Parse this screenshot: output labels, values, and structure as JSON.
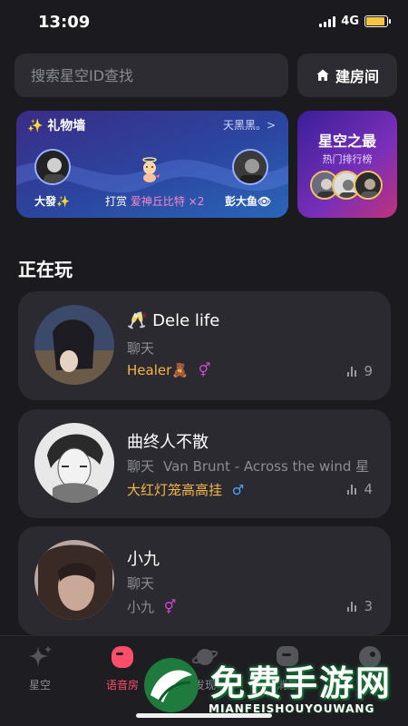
{
  "status": {
    "time": "13:09",
    "network": "4G",
    "battery_level": 0.9
  },
  "search": {
    "placeholder": "搜索星空ID查找"
  },
  "build_room": {
    "label": "建房间"
  },
  "gift_wall": {
    "title": "✨ 礼物墙",
    "right_text": "天黑黑。>",
    "sender": "大發✨",
    "action": "打赏",
    "gift": "爱神丘比特 ×2",
    "receiver": "彭大鱼👁"
  },
  "ranking": {
    "title": "星空之最",
    "subtitle": "热门排行榜"
  },
  "section": {
    "title": "正在玩"
  },
  "rooms": [
    {
      "name": "🥂 Dele life",
      "category": "聊天",
      "now_playing": "",
      "host": "Healer🧸",
      "gender_symbol": "⚥",
      "gender_color": "#d04ad8",
      "host_color": "#f5b54a",
      "count": "9"
    },
    {
      "name": "曲终人不散",
      "category": "聊天",
      "now_playing": "Van Brunt - Across the wind  星",
      "host": "大红灯笼高高挂",
      "gender_symbol": "♂",
      "gender_color": "#4aa6ff",
      "host_color": "#f5b54a",
      "count": "4"
    },
    {
      "name": "小九",
      "category": "聊天",
      "now_playing": "",
      "host": "小九",
      "gender_symbol": "⚥",
      "gender_color": "#d04ad8",
      "host_color": "#8c8c94",
      "count": "3"
    }
  ],
  "tabs": [
    {
      "label": "星空",
      "icon": "sparkle-icon",
      "active": false
    },
    {
      "label": "语音房",
      "icon": "voice-room-icon",
      "active": true
    },
    {
      "label": "发现",
      "icon": "planet-icon",
      "active": false
    },
    {
      "label": "消息",
      "icon": "message-icon",
      "active": false
    },
    {
      "label": "我的",
      "icon": "profile-icon",
      "active": false
    }
  ],
  "watermark": {
    "text": "免费手游网",
    "sub": "MIANFEISHOUYOUWANG"
  },
  "colors": {
    "background": "#1b1b1f",
    "card": "#2a2a30",
    "accent": "#ff4d6a",
    "host_gold": "#f5b54a"
  }
}
